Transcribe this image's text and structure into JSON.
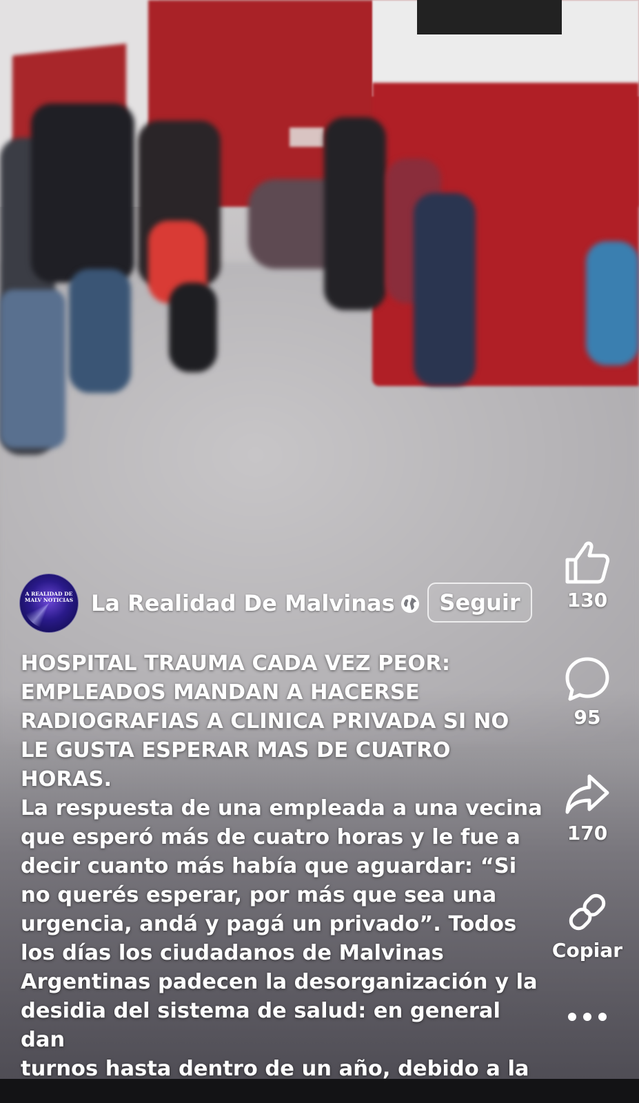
{
  "post": {
    "author_name": "La Realidad De Malvinas",
    "avatar_text": "A REALIDAD DE MALV NOTICIAS",
    "follow_label": "Seguir",
    "headline": "HOSPITAL TRAUMA CADA VEZ PEOR:\nEMPLEADOS MANDAN A HACERSE\nRADIOGRAFIAS A CLINICA PRIVADA SI NO\nLE GUSTA ESPERAR MAS DE CUATRO\nHORAS.",
    "body": "La respuesta de una empleada a una vecina\nque esperó más de cuatro horas y le fue a\ndecir cuanto más había que aguardar: “Si\nno querés esperar, por más que sea una\nurgencia, andá y pagá un privado”.  Todos\nlos días los ciudadanos de Malvinas\nArgentinas padecen la desorganización y la\ndesidia del sistema de salud: en general dan\nturnos hasta dentro de un año, debido a la"
  },
  "actions": {
    "like_count": "130",
    "comment_count": "95",
    "share_count": "170",
    "copy_label": "Copiar"
  },
  "icons": {
    "like": "thumbs-up-icon",
    "comment": "comment-bubble-icon",
    "share": "share-arrow-icon",
    "copy": "link-icon",
    "more": "more-dots-icon",
    "globe": "globe-icon"
  }
}
